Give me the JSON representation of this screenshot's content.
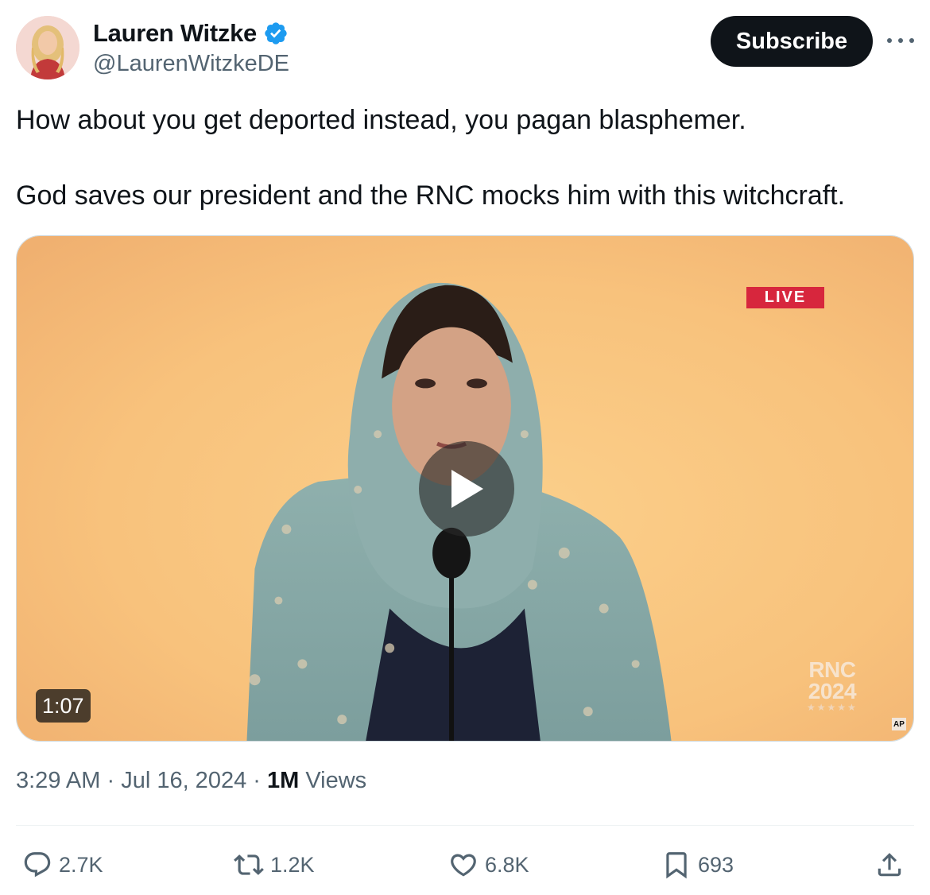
{
  "author": {
    "name": "Lauren Witzke",
    "handle": "@LaurenWitzkeDE",
    "verified": true
  },
  "header": {
    "subscribe_label": "Subscribe"
  },
  "tweet": {
    "paragraphs": [
      "How about you get deported instead, you pagan blasphemer.",
      "God saves our president and the RNC mocks him with this witchcraft."
    ]
  },
  "media": {
    "live_badge": "LIVE",
    "duration": "1:07",
    "watermark_line1": "RNC",
    "watermark_line2": "2024",
    "watermark_stars": "★★★★★",
    "agency_logo": "AP"
  },
  "meta": {
    "time": "3:29 AM",
    "sep1": " · ",
    "date": "Jul 16, 2024",
    "sep2": " · ",
    "views_count": "1M",
    "views_label": " Views"
  },
  "actions": {
    "replies": "2.7K",
    "reposts": "1.2K",
    "likes": "6.8K",
    "bookmarks": "693"
  },
  "colors": {
    "accent_verified": "#1d9bf0",
    "text_primary": "#0f1419",
    "text_secondary": "#536471",
    "live_red": "#d7263d"
  }
}
